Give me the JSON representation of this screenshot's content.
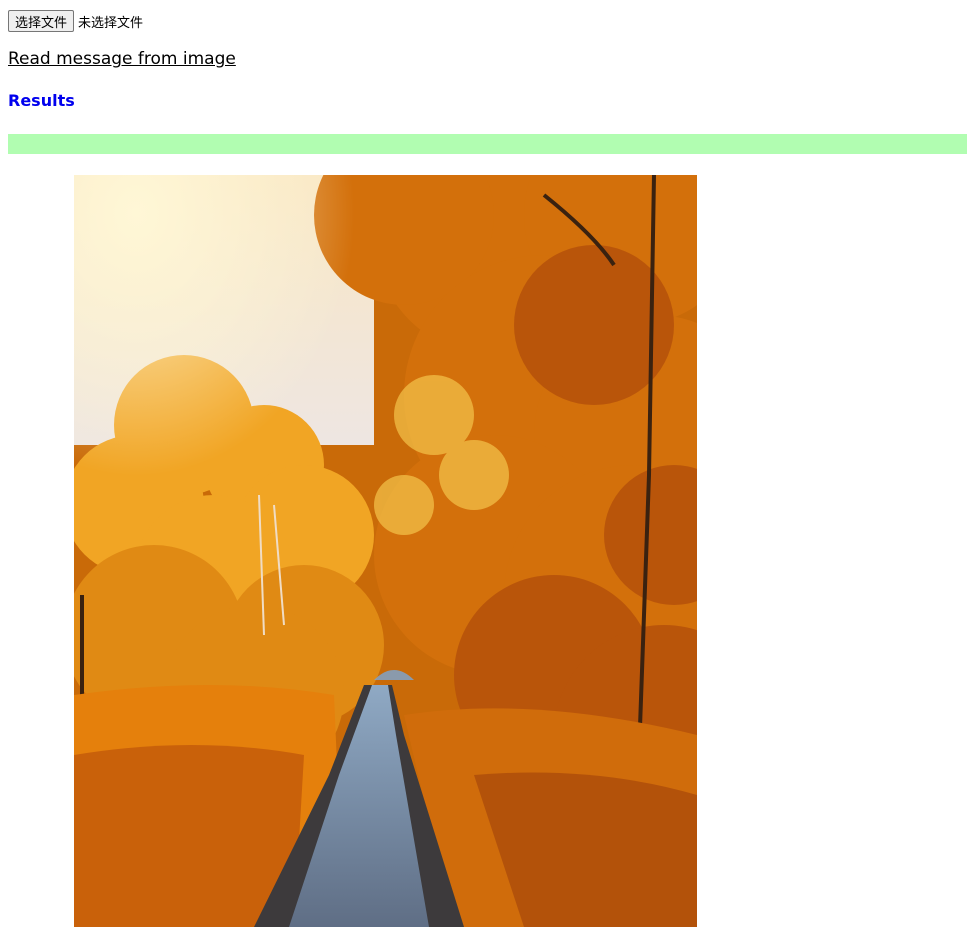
{
  "file_input": {
    "button_label": "选择文件",
    "status_text": "未选择文件"
  },
  "read_link": "Read message from image",
  "results": {
    "title": "Results",
    "title_color": "#0000ee",
    "bar_color": "#b1fdb1",
    "text": ""
  },
  "image": {
    "subject": "autumn forest path",
    "accent": "#e07b0c"
  }
}
